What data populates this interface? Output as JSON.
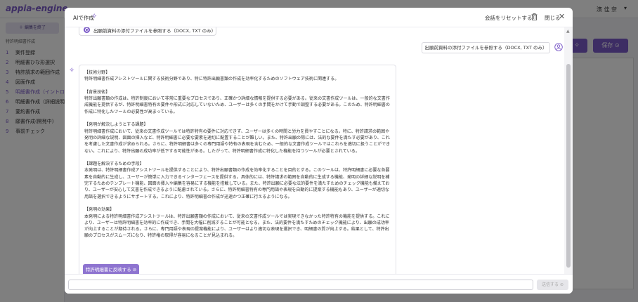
{
  "background": {
    "logo": "appia-engine",
    "user": "濱 佳 奈",
    "edit_button": "＋ 編集を終了",
    "section_title": "特許明細書作成",
    "steps": [
      {
        "num": "1",
        "label": "案件登録"
      },
      {
        "num": "2",
        "label": "明細書ひな形選択"
      },
      {
        "num": "3",
        "label": "特許請求の範囲作成"
      },
      {
        "num": "4",
        "label": "図面作成"
      },
      {
        "num": "5",
        "label": "明細書作成（イントロ"
      },
      {
        "num": "6",
        "label": "明細書作成（詳細説明"
      },
      {
        "num": "7",
        "label": "要約書作成"
      },
      {
        "num": "8",
        "label": "願書作成(開発中)"
      },
      {
        "num": "9",
        "label": "事前チェック"
      }
    ],
    "active_step": 4,
    "save_button": "保存 ⊙",
    "magic_button": "✧"
  },
  "modal": {
    "title": "AIで作成",
    "reset_label": "会話をリセットする",
    "close_label": "閉じる",
    "previous_option": "出願前資料の添付ファイルを参照する（DOCX, TXT のみ）",
    "user_message": "出願前資料の添付ファイルを参照する（DOCX, TXT のみ）",
    "ai_response": "【技術分野】\n特許明細書作成アシストツールに関する技術分野であり、特に特許出願書類の作成を効率化するためのソフトウェア技術に関連する。\n\n【背景技術】\n特許出願書類の作成は、特許制度において非常に重要なプロセスであり、正確かつ詳細な情報を提供する必要がある。従来の文書作成ツールは、一般的な文書作成機能を提供するが、特許明細書特有の要件や形式に対応していないため、ユーザーは多くの手間をかけて手動で調整する必要がある。このため、特許明細書の作成に特化したツールの必要性が高まっている。\n\n【発明が解決しようとする課題】\n特許明細書作成において、従来の文書作成ツールでは特許特有の要件に対応できず、ユーザーは多くの時間と労力を費やすことになる。特に、特許請求の範囲や発明の詳細な説明、図面の挿入など、特許明細書に必要な要素を適切に配置することが難しい。また、特許出願の際には、法的な要件を満たす必要があり、これを考慮した文書作成が求められる。さらに、特許明細書は多くの専門用語や特有の表現を含むため、一般的な文書作成ツールではこれらを適切に扱うことができない。これにより、特許出願の成功率が低下する可能性がある。したがって、特許明細書作成に特化した機能を持つツールが必要とされている。\n\n【課題を解決するための手段】\n本発明は、特許明細書作成アシストツールを提供することにより、特許出願書類の作成を効率化することを目的とする。このツールは、特許明細書に必要な各要素を自動的に生成し、ユーザーが簡単に入力できるインターフェースを提供する。具体的には、特許請求の範囲を自動的に生成する機能、発明の詳細な説明を補完するためのテンプレート機能、図面の挿入や編集を容易にする機能を搭載している。また、特許出願に必要な法的要件を満たすためのチェック機能も備えており、ユーザーが安心して文書を作成できるように配慮されている。さらに、特許明細書特有の専門用語や表現を自動的に提案する機能もあり、ユーザーが適切な用語を選択できるようにサポートする。これにより、特許明細書の作成が迅速かつ正確に行えるようになる。\n\n【発明の効果】\n本発明による特許明細書作成アシストツールは、特許出願書類の作成において、従来の文書作成ツールでは実現できなかった特許特有の機能を提供する。これにより、ユーザーは特許明細書を効率的に作成でき、手間を大幅に削減することが可能となる。また、法的要件を満たすためのチェック機能により、出願の成功率が向上することが期待される。さらに、専門用語や表現の提案機能により、ユーザーはより適切な表現を選択でき、明細書の質が向上する。結果として、特許出願のプロセスがスムーズになり、特許権の取得が容易になることが見込まれる。",
    "reflect_button": "特許明細書に反映する ⊘",
    "input_placeholder": "",
    "send_button": "送信する ⊘"
  },
  "colors": {
    "accent": "#7b5ac8",
    "button": "#8e74d0"
  }
}
